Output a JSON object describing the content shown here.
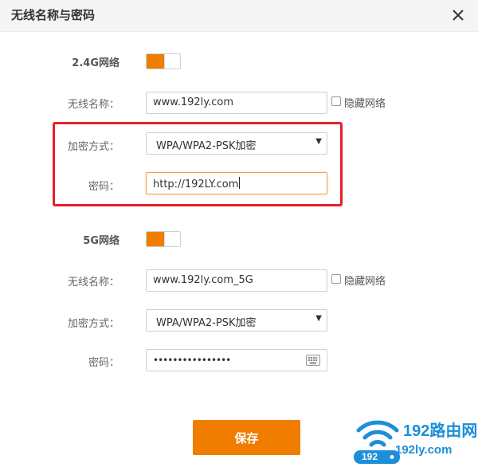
{
  "dialog": {
    "title": "无线名称与密码"
  },
  "band_24": {
    "label": "2.4G网络",
    "enabled": true,
    "ssid_label": "无线名称：",
    "ssid_value": "www.192ly.com",
    "hide_label": "隐藏网络",
    "security_label": "加密方式：",
    "security_value": "WPA/WPA2-PSK加密",
    "password_label": "密码：",
    "password_value": "http://192LY.com"
  },
  "band_5": {
    "label": "5G网络",
    "enabled": true,
    "ssid_label": "无线名称：",
    "ssid_value": "www.192ly.com_5G",
    "hide_label": "隐藏网络",
    "security_label": "加密方式：",
    "security_value": "WPA/WPA2-PSK加密",
    "password_label": "密码：",
    "password_masked": "••••••••••••••••"
  },
  "actions": {
    "save_label": "保存"
  },
  "watermark": {
    "brand": "192路由网",
    "url": "192ly.com",
    "icon_text": "192"
  },
  "colors": {
    "accent": "#f07c00",
    "highlight": "#e8202a",
    "watermark": "#1d8fd8"
  }
}
